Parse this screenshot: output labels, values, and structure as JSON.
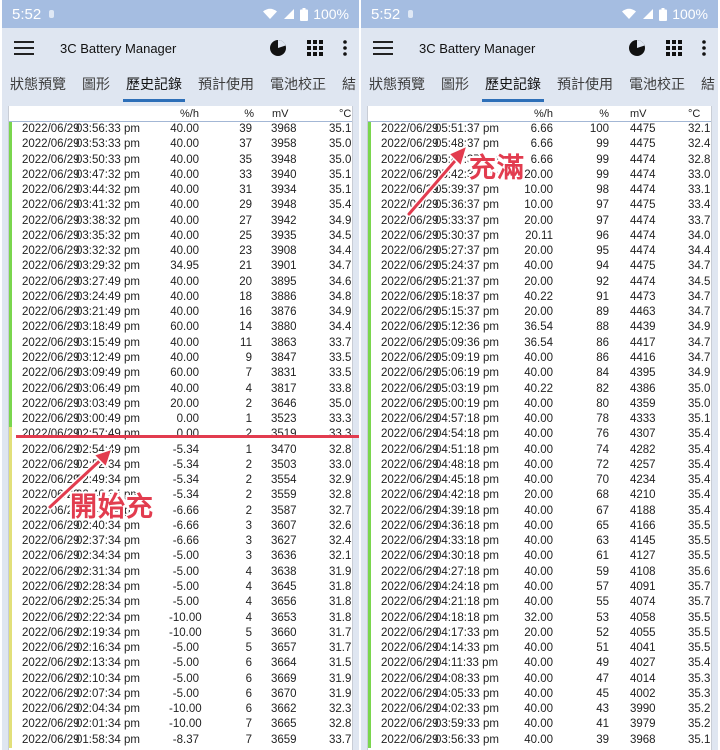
{
  "left": {
    "status": {
      "time": "5:52",
      "battery": "100%"
    },
    "app_title": "3C Battery Manager",
    "tabs": [
      {
        "label": "狀態預覽",
        "active": false
      },
      {
        "label": "圖形",
        "active": false
      },
      {
        "label": "歷史記錄",
        "active": true
      },
      {
        "label": "預計使用",
        "active": false
      },
      {
        "label": "電池校正",
        "active": false
      },
      {
        "label": "結",
        "active": false
      }
    ],
    "headers": {
      "rate": "%/h",
      "pct": "%",
      "mv": "mV",
      "c": "°C"
    },
    "rows": [
      [
        "2022/06/29",
        "03:56:33 pm",
        "40.00",
        "39",
        "3968",
        "35.1"
      ],
      [
        "2022/06/29",
        "03:53:33 pm",
        "40.00",
        "37",
        "3958",
        "35.0"
      ],
      [
        "2022/06/29",
        "03:50:33 pm",
        "40.00",
        "35",
        "3948",
        "35.0"
      ],
      [
        "2022/06/29",
        "03:47:32 pm",
        "40.00",
        "33",
        "3940",
        "35.1"
      ],
      [
        "2022/06/29",
        "03:44:32 pm",
        "40.00",
        "31",
        "3934",
        "35.1"
      ],
      [
        "2022/06/29",
        "03:41:32 pm",
        "40.00",
        "29",
        "3948",
        "35.4"
      ],
      [
        "2022/06/29",
        "03:38:32 pm",
        "40.00",
        "27",
        "3942",
        "34.9"
      ],
      [
        "2022/06/29",
        "03:35:32 pm",
        "40.00",
        "25",
        "3935",
        "34.5"
      ],
      [
        "2022/06/29",
        "03:32:32 pm",
        "40.00",
        "23",
        "3908",
        "34.4"
      ],
      [
        "2022/06/29",
        "03:29:32 pm",
        "34.95",
        "21",
        "3901",
        "34.7"
      ],
      [
        "2022/06/29",
        "03:27:49 pm",
        "40.00",
        "20",
        "3895",
        "34.6"
      ],
      [
        "2022/06/29",
        "03:24:49 pm",
        "40.00",
        "18",
        "3886",
        "34.8"
      ],
      [
        "2022/06/29",
        "03:21:49 pm",
        "40.00",
        "16",
        "3876",
        "34.9"
      ],
      [
        "2022/06/29",
        "03:18:49 pm",
        "60.00",
        "14",
        "3880",
        "34.4"
      ],
      [
        "2022/06/29",
        "03:15:49 pm",
        "40.00",
        "11",
        "3863",
        "33.7"
      ],
      [
        "2022/06/29",
        "03:12:49 pm",
        "40.00",
        "9",
        "3847",
        "33.5"
      ],
      [
        "2022/06/29",
        "03:09:49 pm",
        "60.00",
        "7",
        "3831",
        "33.5"
      ],
      [
        "2022/06/29",
        "03:06:49 pm",
        "40.00",
        "4",
        "3817",
        "33.8"
      ],
      [
        "2022/06/29",
        "03:03:49 pm",
        "20.00",
        "2",
        "3646",
        "35.0"
      ],
      [
        "2022/06/29",
        "03:00:49 pm",
        "0.00",
        "1",
        "3523",
        "33.3"
      ],
      [
        "2022/06/29",
        "02:57:49 pm",
        "0.00",
        "2",
        "3519",
        "33.3"
      ],
      [
        "2022/06/29",
        "02:54:49 pm",
        "-5.34",
        "1",
        "3470",
        "32.8"
      ],
      [
        "2022/06/29",
        "02:52:34 pm",
        "-5.34",
        "2",
        "3503",
        "33.0"
      ],
      [
        "2022/06/29",
        "02:49:34 pm",
        "-5.34",
        "2",
        "3554",
        "32.9"
      ],
      [
        "2022/06/29",
        "02:46:34 pm",
        "-5.34",
        "2",
        "3559",
        "32.8"
      ],
      [
        "2022/06/29",
        "02:43:34 pm",
        "-6.66",
        "2",
        "3587",
        "32.7"
      ],
      [
        "2022/06/29",
        "02:40:34 pm",
        "-6.66",
        "3",
        "3607",
        "32.6"
      ],
      [
        "2022/06/29",
        "02:37:34 pm",
        "-6.66",
        "3",
        "3627",
        "32.4"
      ],
      [
        "2022/06/29",
        "02:34:34 pm",
        "-5.00",
        "3",
        "3636",
        "32.1"
      ],
      [
        "2022/06/29",
        "02:31:34 pm",
        "-5.00",
        "4",
        "3638",
        "31.9"
      ],
      [
        "2022/06/29",
        "02:28:34 pm",
        "-5.00",
        "4",
        "3645",
        "31.8"
      ],
      [
        "2022/06/29",
        "02:25:34 pm",
        "-5.00",
        "4",
        "3656",
        "31.8"
      ],
      [
        "2022/06/29",
        "02:22:34 pm",
        "-10.00",
        "4",
        "3653",
        "31.8"
      ],
      [
        "2022/06/29",
        "02:19:34 pm",
        "-10.00",
        "5",
        "3660",
        "31.7"
      ],
      [
        "2022/06/29",
        "02:16:34 pm",
        "-5.00",
        "5",
        "3657",
        "31.7"
      ],
      [
        "2022/06/29",
        "02:13:34 pm",
        "-5.00",
        "6",
        "3664",
        "31.5"
      ],
      [
        "2022/06/29",
        "02:10:34 pm",
        "-5.00",
        "6",
        "3669",
        "31.9"
      ],
      [
        "2022/06/29",
        "02:07:34 pm",
        "-5.00",
        "6",
        "3670",
        "31.9"
      ],
      [
        "2022/06/29",
        "02:04:34 pm",
        "-10.00",
        "6",
        "3662",
        "32.3"
      ],
      [
        "2022/06/29",
        "02:01:34 pm",
        "-10.00",
        "7",
        "3665",
        "32.8"
      ],
      [
        "2022/06/29",
        "01:58:34 pm",
        "-8.37",
        "7",
        "3659",
        "33.7"
      ]
    ],
    "annotation": "開始充"
  },
  "right": {
    "status": {
      "time": "5:52",
      "battery": "100%"
    },
    "app_title": "3C Battery Manager",
    "tabs": [
      {
        "label": "狀態預覽",
        "active": false
      },
      {
        "label": "圖形",
        "active": false
      },
      {
        "label": "歷史記錄",
        "active": true
      },
      {
        "label": "預計使用",
        "active": false
      },
      {
        "label": "電池校正",
        "active": false
      },
      {
        "label": "結",
        "active": false
      }
    ],
    "headers": {
      "rate": "%/h",
      "pct": "%",
      "mv": "mV",
      "c": "°C"
    },
    "rows": [
      [
        "2022/06/29",
        "05:51:37 pm",
        "6.66",
        "100",
        "4475",
        "32.1"
      ],
      [
        "2022/06/29",
        "05:48:37 pm",
        "6.66",
        "99",
        "4475",
        "32.4"
      ],
      [
        "2022/06/29",
        "05:45:37 pm",
        "6.66",
        "99",
        "4474",
        "32.8"
      ],
      [
        "2022/06/29",
        "05:42:37 pm",
        "20.00",
        "99",
        "4474",
        "33.0"
      ],
      [
        "2022/06/29",
        "05:39:37 pm",
        "10.00",
        "98",
        "4474",
        "33.1"
      ],
      [
        "2022/06/29",
        "05:36:37 pm",
        "10.00",
        "97",
        "4475",
        "33.4"
      ],
      [
        "2022/06/29",
        "05:33:37 pm",
        "20.00",
        "97",
        "4474",
        "33.7"
      ],
      [
        "2022/06/29",
        "05:30:37 pm",
        "20.11",
        "96",
        "4474",
        "34.0"
      ],
      [
        "2022/06/29",
        "05:27:37 pm",
        "20.00",
        "95",
        "4474",
        "34.4"
      ],
      [
        "2022/06/29",
        "05:24:37 pm",
        "40.00",
        "94",
        "4475",
        "34.7"
      ],
      [
        "2022/06/29",
        "05:21:37 pm",
        "20.00",
        "92",
        "4474",
        "34.5"
      ],
      [
        "2022/06/29",
        "05:18:37 pm",
        "40.22",
        "91",
        "4473",
        "34.7"
      ],
      [
        "2022/06/29",
        "05:15:37 pm",
        "20.00",
        "89",
        "4463",
        "34.7"
      ],
      [
        "2022/06/29",
        "05:12:36 pm",
        "36.54",
        "88",
        "4439",
        "34.9"
      ],
      [
        "2022/06/29",
        "05:09:36 pm",
        "36.54",
        "86",
        "4417",
        "34.7"
      ],
      [
        "2022/06/29",
        "05:09:19 pm",
        "40.00",
        "86",
        "4416",
        "34.7"
      ],
      [
        "2022/06/29",
        "05:06:19 pm",
        "40.00",
        "84",
        "4395",
        "34.9"
      ],
      [
        "2022/06/29",
        "05:03:19 pm",
        "40.22",
        "82",
        "4386",
        "35.0"
      ],
      [
        "2022/06/29",
        "05:00:19 pm",
        "40.00",
        "80",
        "4359",
        "35.0"
      ],
      [
        "2022/06/29",
        "04:57:18 pm",
        "40.00",
        "78",
        "4333",
        "35.1"
      ],
      [
        "2022/06/29",
        "04:54:18 pm",
        "40.00",
        "76",
        "4307",
        "35.4"
      ],
      [
        "2022/06/29",
        "04:51:18 pm",
        "40.00",
        "74",
        "4282",
        "35.4"
      ],
      [
        "2022/06/29",
        "04:48:18 pm",
        "40.00",
        "72",
        "4257",
        "35.4"
      ],
      [
        "2022/06/29",
        "04:45:18 pm",
        "40.00",
        "70",
        "4234",
        "35.4"
      ],
      [
        "2022/06/29",
        "04:42:18 pm",
        "20.00",
        "68",
        "4210",
        "35.4"
      ],
      [
        "2022/06/29",
        "04:39:18 pm",
        "40.00",
        "67",
        "4188",
        "35.4"
      ],
      [
        "2022/06/29",
        "04:36:18 pm",
        "40.00",
        "65",
        "4166",
        "35.5"
      ],
      [
        "2022/06/29",
        "04:33:18 pm",
        "40.00",
        "63",
        "4145",
        "35.5"
      ],
      [
        "2022/06/29",
        "04:30:18 pm",
        "40.00",
        "61",
        "4127",
        "35.5"
      ],
      [
        "2022/06/29",
        "04:27:18 pm",
        "40.00",
        "59",
        "4108",
        "35.6"
      ],
      [
        "2022/06/29",
        "04:24:18 pm",
        "40.00",
        "57",
        "4091",
        "35.7"
      ],
      [
        "2022/06/29",
        "04:21:18 pm",
        "40.00",
        "55",
        "4074",
        "35.7"
      ],
      [
        "2022/06/29",
        "04:18:18 pm",
        "32.00",
        "53",
        "4058",
        "35.5"
      ],
      [
        "2022/06/29",
        "04:17:33 pm",
        "20.00",
        "52",
        "4055",
        "35.5"
      ],
      [
        "2022/06/29",
        "04:14:33 pm",
        "40.00",
        "51",
        "4041",
        "35.5"
      ],
      [
        "2022/06/29",
        "04:11:33 pm",
        "40.00",
        "49",
        "4027",
        "35.4"
      ],
      [
        "2022/06/29",
        "04:08:33 pm",
        "40.00",
        "47",
        "4014",
        "35.3"
      ],
      [
        "2022/06/29",
        "04:05:33 pm",
        "40.00",
        "45",
        "4002",
        "35.3"
      ],
      [
        "2022/06/29",
        "04:02:33 pm",
        "40.00",
        "43",
        "3990",
        "35.2"
      ],
      [
        "2022/06/29",
        "03:59:33 pm",
        "40.00",
        "41",
        "3979",
        "35.2"
      ],
      [
        "2022/06/29",
        "03:56:33 pm",
        "40.00",
        "39",
        "3968",
        "35.1"
      ]
    ],
    "annotation": "充滿"
  },
  "colors": {
    "accent": "#2d6fb8",
    "annotation": "#e23c4f",
    "statusbar": "#a5bde1",
    "appbar": "#dfe6f1",
    "charging_green": "#7ad64e",
    "discharging_yellow": "#e2e07a"
  }
}
